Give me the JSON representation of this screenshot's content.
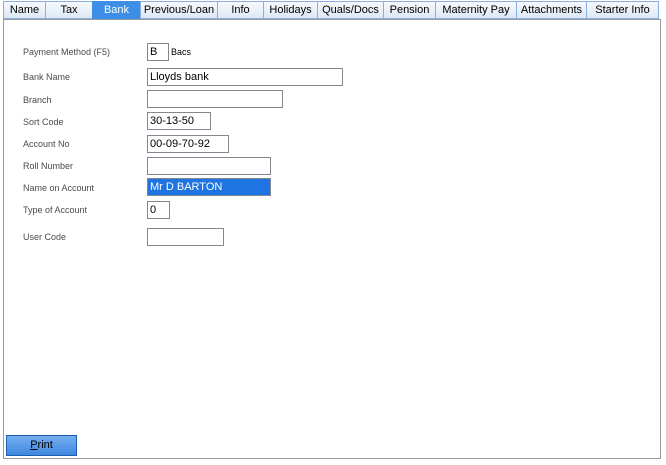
{
  "tabs": [
    {
      "label": "Name",
      "active": false
    },
    {
      "label": "Tax",
      "active": false
    },
    {
      "label": "Bank",
      "active": true
    },
    {
      "label": "Previous/Loan",
      "active": false
    },
    {
      "label": "Info",
      "active": false
    },
    {
      "label": "Holidays",
      "active": false
    },
    {
      "label": "Quals/Docs",
      "active": false
    },
    {
      "label": "Pension",
      "active": false
    },
    {
      "label": "Maternity Pay",
      "active": false
    },
    {
      "label": "Attachments",
      "active": false
    },
    {
      "label": "Starter Info",
      "active": false
    }
  ],
  "form": {
    "payment_method": {
      "label": "Payment Method (F5)",
      "value": "B",
      "suffix": "Bacs"
    },
    "bank_name": {
      "label": "Bank Name",
      "value": "Lloyds bank"
    },
    "branch": {
      "label": "Branch",
      "value": ""
    },
    "sort_code": {
      "label": "Sort Code",
      "value": "30-13-50"
    },
    "account_no": {
      "label": "Account No",
      "value": "00-09-70-92"
    },
    "roll_number": {
      "label": "Roll Number",
      "value": ""
    },
    "name_on_account": {
      "label": "Name on Account",
      "value": "Mr D BARTON"
    },
    "type_of_account": {
      "label": "Type of Account",
      "value": "0"
    },
    "user_code": {
      "label": "User Code",
      "value": ""
    }
  },
  "print_button": {
    "mnemonic": "P",
    "rest": "rint"
  },
  "colors": {
    "active_tab": "#3d8ee6",
    "selection": "#1e74e0",
    "print_button": "#3f88e0"
  }
}
